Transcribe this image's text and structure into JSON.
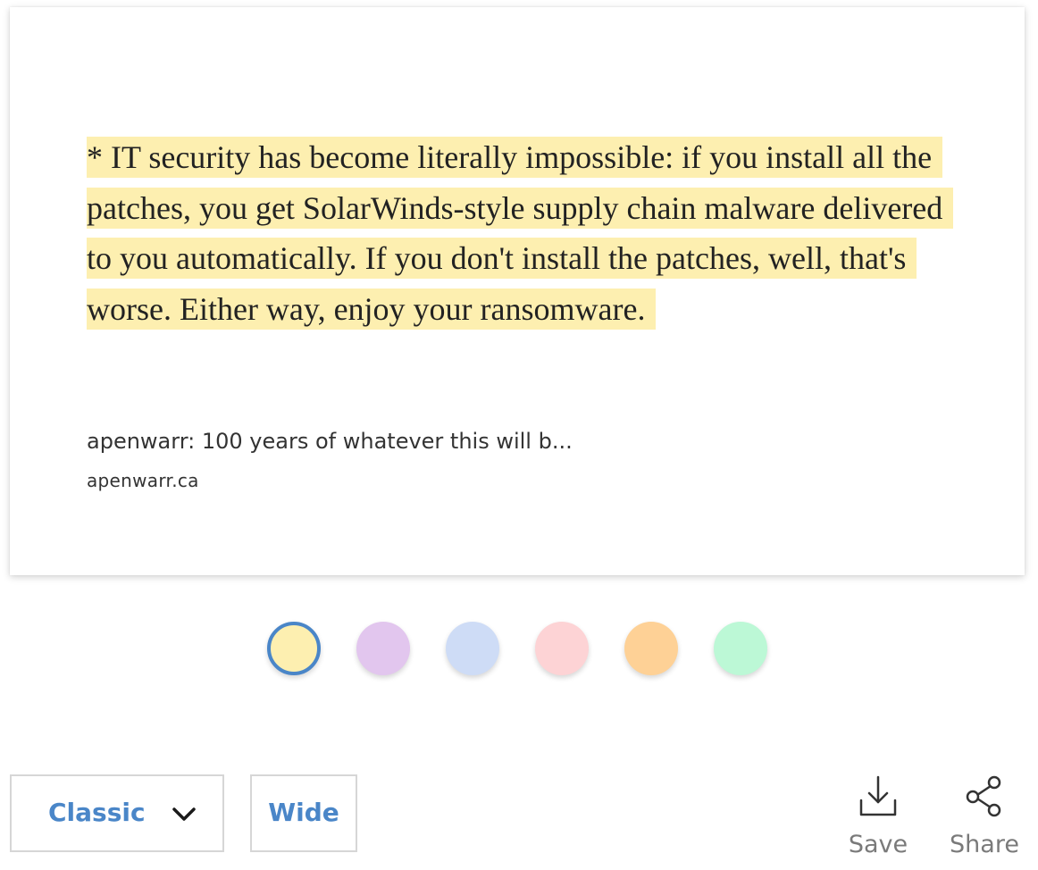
{
  "card": {
    "quote": "* IT security has become literally impossible: if you install all the patches, you get SolarWinds-style supply chain malware delivered to you automatically. If you don't install the patches, well, that's worse. Either way, enjoy your ransomware.",
    "source_title": "apenwarr: 100 years of whatever this will b...",
    "source_domain": "apenwarr.ca",
    "highlight_color": "#fdefb0"
  },
  "swatches": [
    {
      "color": "#fdefb0",
      "selected": true
    },
    {
      "color": "#e2c6ee",
      "selected": false
    },
    {
      "color": "#cedcf6",
      "selected": false
    },
    {
      "color": "#fdd3d5",
      "selected": false
    },
    {
      "color": "#fed196",
      "selected": false
    },
    {
      "color": "#bcf8d6",
      "selected": false
    }
  ],
  "toolbar": {
    "style_label": "Classic",
    "style_icon": "chevron-down-icon",
    "layout_label": "Wide",
    "save_label": "Save",
    "save_icon": "download-icon",
    "share_label": "Share",
    "share_icon": "share-icon"
  },
  "colors": {
    "accent": "#4a86c8",
    "selected_ring": "#4a86c8"
  }
}
